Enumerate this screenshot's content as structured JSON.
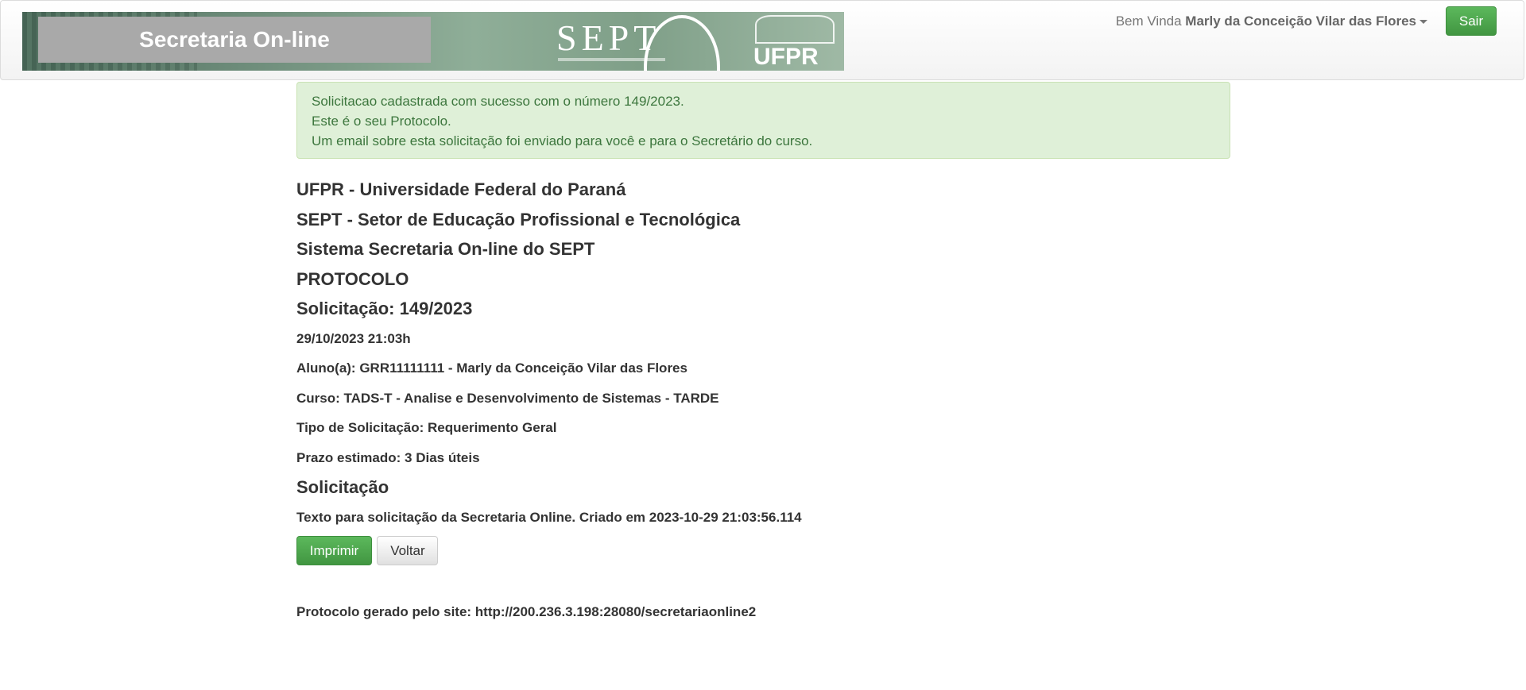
{
  "header": {
    "banner_title": "Secretaria On-line",
    "banner_sept": "SEPT",
    "banner_ufpr": "UFPR",
    "greeting": "Bem Vinda",
    "user_name": "Marly da Conceição Vilar das Flores",
    "logout_label": "Sair"
  },
  "alert": {
    "line1": "Solicitacao cadastrada com sucesso com o número 149/2023.",
    "line2": "Este é o seu Protocolo.",
    "line3": "Um email sobre esta solicitação foi enviado para você e para o Secretário do curso."
  },
  "protocol": {
    "university": "UFPR - Universidade Federal do Paraná",
    "sector": "SEPT - Setor de Educação Profissional e Tecnológica",
    "system": "Sistema Secretaria On-line do SEPT",
    "heading": "PROTOCOLO",
    "request_number": "Solicitação: 149/2023",
    "datetime": "29/10/2023 21:03h",
    "student": "Aluno(a): GRR11111111 - Marly da Conceição Vilar das Flores",
    "course": "Curso: TADS-T - Analise e Desenvolvimento de Sistemas - TARDE",
    "request_type": "Tipo de Solicitação: Requerimento Geral",
    "deadline": "Prazo estimado: 3 Dias úteis",
    "request_heading": "Solicitação",
    "request_text": "Texto para solicitação da Secretaria Online. Criado em 2023-10-29 21:03:56.114",
    "generated_by": "Protocolo gerado pelo site: http://200.236.3.198:28080/secretariaonline2"
  },
  "actions": {
    "print_label": "Imprimir",
    "back_label": "Voltar"
  },
  "colors": {
    "success": "#5cb85c",
    "alert_bg": "#dff0d8",
    "alert_text": "#3c763d"
  }
}
